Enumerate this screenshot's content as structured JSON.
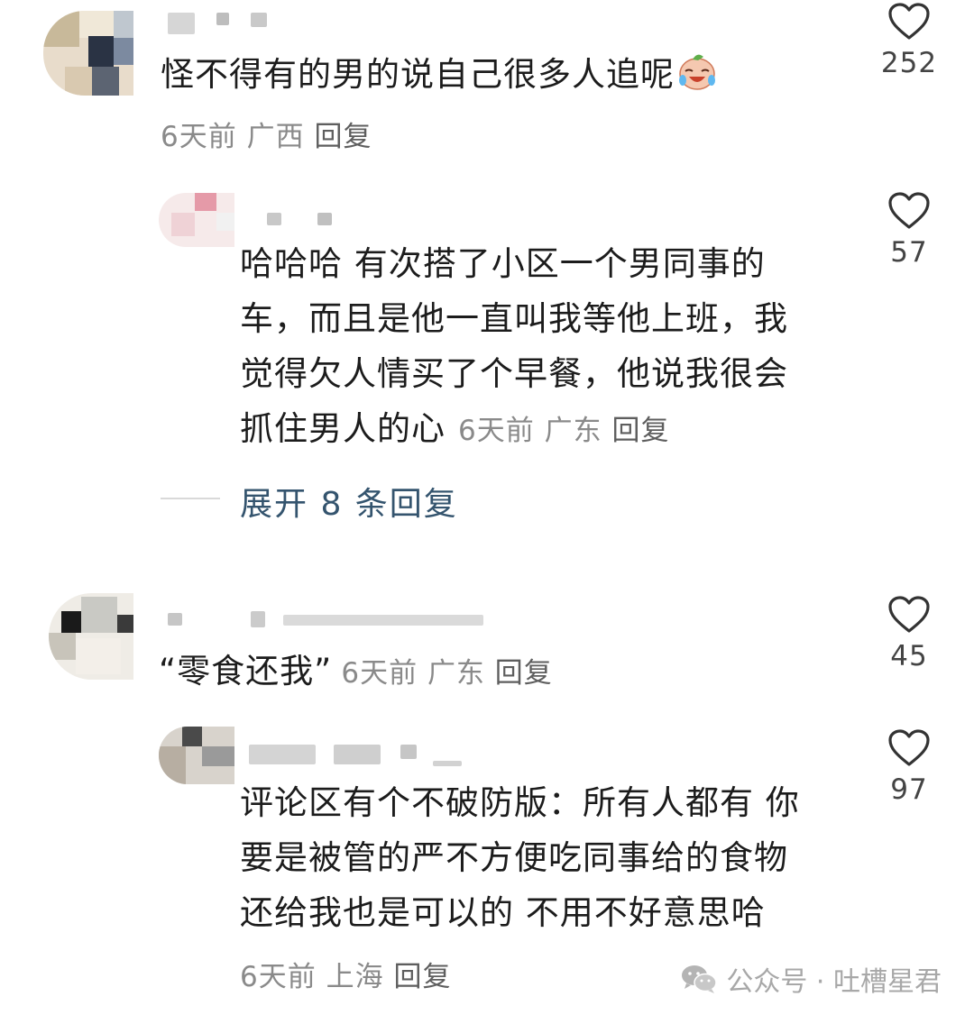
{
  "comments": [
    {
      "text": "怪不得有的男的说自己很多人追呢",
      "emoji": "crying-laughing-face",
      "time": "6天前",
      "location": "广西",
      "reply_label": "回复",
      "likes": "252"
    },
    {
      "text_lines": [
        "哈哈哈  有次搭了小区一个男同事的",
        "车，而且是他一直叫我等他上班，我",
        "觉得欠人情买了个早餐，他说我很会",
        "抓住男人的心"
      ],
      "time": "6天前",
      "location": "广东",
      "reply_label": "回复",
      "likes": "57"
    },
    {
      "text": "“零食还我”",
      "time": "6天前",
      "location": "广东",
      "reply_label": "回复",
      "likes": "45"
    },
    {
      "text_lines": [
        "评论区有个不破防版：所有人都有  你",
        "要是被管的严不方便吃同事给的食物",
        "还给我也是可以的  不用不好意思哈"
      ],
      "time": "6天前",
      "location": "上海",
      "reply_label": "回复",
      "likes": "97"
    }
  ],
  "expand_replies": "展开 8 条回复",
  "watermark": {
    "icon": "wechat-icon",
    "text": "公众号 · 吐槽星君"
  },
  "colors": {
    "text": "#1c1c1c",
    "meta": "#8a8a8a",
    "expand": "#34546e",
    "heart": "#333333"
  }
}
